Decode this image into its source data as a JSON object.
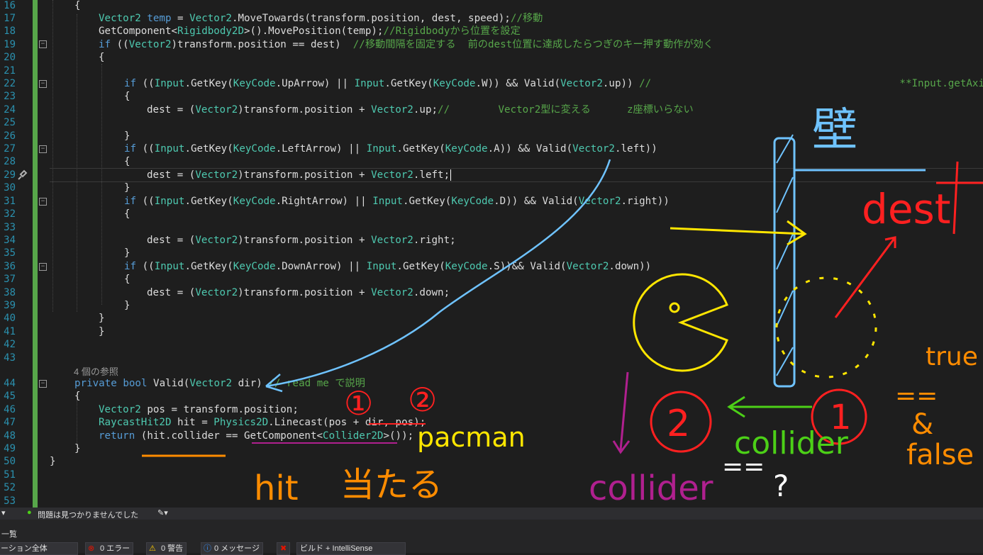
{
  "editor": {
    "line_numbers": [
      "16",
      "17",
      "18",
      "19",
      "20",
      "21",
      "22",
      "23",
      "24",
      "25",
      "26",
      "27",
      "28",
      "29",
      "30",
      "31",
      "32",
      "33",
      "34",
      "35",
      "36",
      "37",
      "38",
      "39",
      "40",
      "41",
      "42",
      "43",
      "44",
      "45",
      "46",
      "47",
      "48",
      "49",
      "50",
      "51",
      "52",
      "53"
    ],
    "lines": {
      "l16": "{",
      "l17a": "Vector2 ",
      "l17b": "temp",
      "l17c": " = ",
      "l17d": "Vector2",
      "l17e": ".MoveTowards(transform.position, dest, speed);",
      "l17f": "//移動",
      "l18a": "GetComponent<",
      "l18b": "Rigidbody2D",
      "l18c": ">().MovePosition(temp);",
      "l18d": "//Rigidbodyから位置を設定",
      "l19a": "if",
      "l19b": " ((",
      "l19c": "Vector2",
      "l19d": ")transform.position == dest)  ",
      "l19e": "//移動間隔を固定する  前のdest位置に達成したらつぎのキー押す動作が効く",
      "l20": "{",
      "l22a": "if",
      "l22b": " ((",
      "l22c": "Input",
      "l22d": ".GetKey(",
      "l22e": "KeyCode",
      "l22f": ".UpArrow) || ",
      "l22g": "Input",
      "l22h": ".GetKey(",
      "l22i": "KeyCode",
      "l22j": ".W)) && Valid(",
      "l22k": "Vector2",
      "l22l": ".up)) ",
      "l22m": "//                                         **Input.getAxis",
      "l23": "{",
      "l24a": "dest = (",
      "l24b": "Vector2",
      "l24c": ")transform.position + ",
      "l24d": "Vector2",
      "l24e": ".up;",
      "l24f": "//        Vector2型に変える      z座標いらない",
      "l26": "}",
      "l27a": "if",
      "l27b": " ((",
      "l27c": "Input",
      "l27d": ".GetKey(",
      "l27e": "KeyCode",
      "l27f": ".LeftArrow) || ",
      "l27g": "Input",
      "l27h": ".GetKey(",
      "l27i": "KeyCode",
      "l27j": ".A)) && Valid(",
      "l27k": "Vector2",
      "l27l": ".left))",
      "l28": "{",
      "l29a": "dest = (",
      "l29b": "Vector2",
      "l29c": ")transform.position + ",
      "l29d": "Vector2",
      "l29e": ".left;",
      "l30": "}",
      "l31a": "if",
      "l31b": " ((",
      "l31c": "Input",
      "l31d": ".GetKey(",
      "l31e": "KeyCode",
      "l31f": ".RightArrow) || ",
      "l31g": "Input",
      "l31h": ".GetKey(",
      "l31i": "KeyCode",
      "l31j": ".D)) && Valid(",
      "l31k": "Vector2",
      "l31l": ".right))",
      "l32": "{",
      "l34a": "dest = (",
      "l34b": "Vector2",
      "l34c": ")transform.position + ",
      "l34d": "Vector2",
      "l34e": ".right;",
      "l35": "}",
      "l36a": "if",
      "l36b": " ((",
      "l36c": "Input",
      "l36d": ".GetKey(",
      "l36e": "KeyCode",
      "l36f": ".DownArrow) || ",
      "l36g": "Input",
      "l36h": ".GetKey(",
      "l36i": "KeyCode",
      "l36j": ".S))&& Valid(",
      "l36k": "Vector2",
      "l36l": ".down))",
      "l37": "{",
      "l38a": "dest = (",
      "l38b": "Vector2",
      "l38c": ")transform.position + ",
      "l38d": "Vector2",
      "l38e": ".down;",
      "l39": "}",
      "l40": "}",
      "l41": "}",
      "l43ref": "4 個の参照",
      "l44a": "private",
      "l44b": " ",
      "l44c": "bool",
      "l44d": " Valid(",
      "l44e": "Vector2",
      "l44f": " dir) ",
      "l44g": "// read me で説明",
      "l45": "{",
      "l46a": "Vector2",
      "l46b": " pos = transform.position;",
      "l47a": "RaycastHit2D",
      "l47b": " hit = ",
      "l47c": "Physics2D",
      "l47d": ".Linecast(pos + dir, pos);",
      "l48a": "return",
      "l48b": " (hit.collider == GetComponent<",
      "l48c": "Collider2D",
      "l48d": ">());",
      "l49": "}",
      "l50": "}"
    }
  },
  "annotations": {
    "wall": "壁",
    "dest": "dest",
    "true_label": "true",
    "eq": "==",
    "false_label": "false",
    "hit": "hit",
    "hit_verb": "当たる",
    "collider_bottom": "collider",
    "pacman": "pacman",
    "collider_green": "collider",
    "collider_purple": "collider",
    "eq2": "==",
    "question": "?",
    "circle_1": "①",
    "circle_2": "②",
    "big_1": "1",
    "big_2": "2"
  },
  "status_bar": {
    "no_issues": "問題は見つかりませんでした"
  },
  "error_panel": {
    "title": "一覧",
    "scope": "ーション全体",
    "errors": "0 エラー",
    "warnings": "0 警告",
    "messages": "0 メッセージ",
    "build_filter": "ビルド + IntelliSense"
  },
  "colors": {
    "keyword": "#569cd6",
    "type": "#4ec9b0",
    "comment": "#57a64a",
    "blue_pen": "#6fc3ff",
    "yellow_pen": "#ffe600",
    "red_pen": "#ff2020",
    "orange_pen": "#ff8c00",
    "green_pen": "#4cd017",
    "purple_pen": "#b0208f",
    "white_pen": "#ffffff"
  }
}
